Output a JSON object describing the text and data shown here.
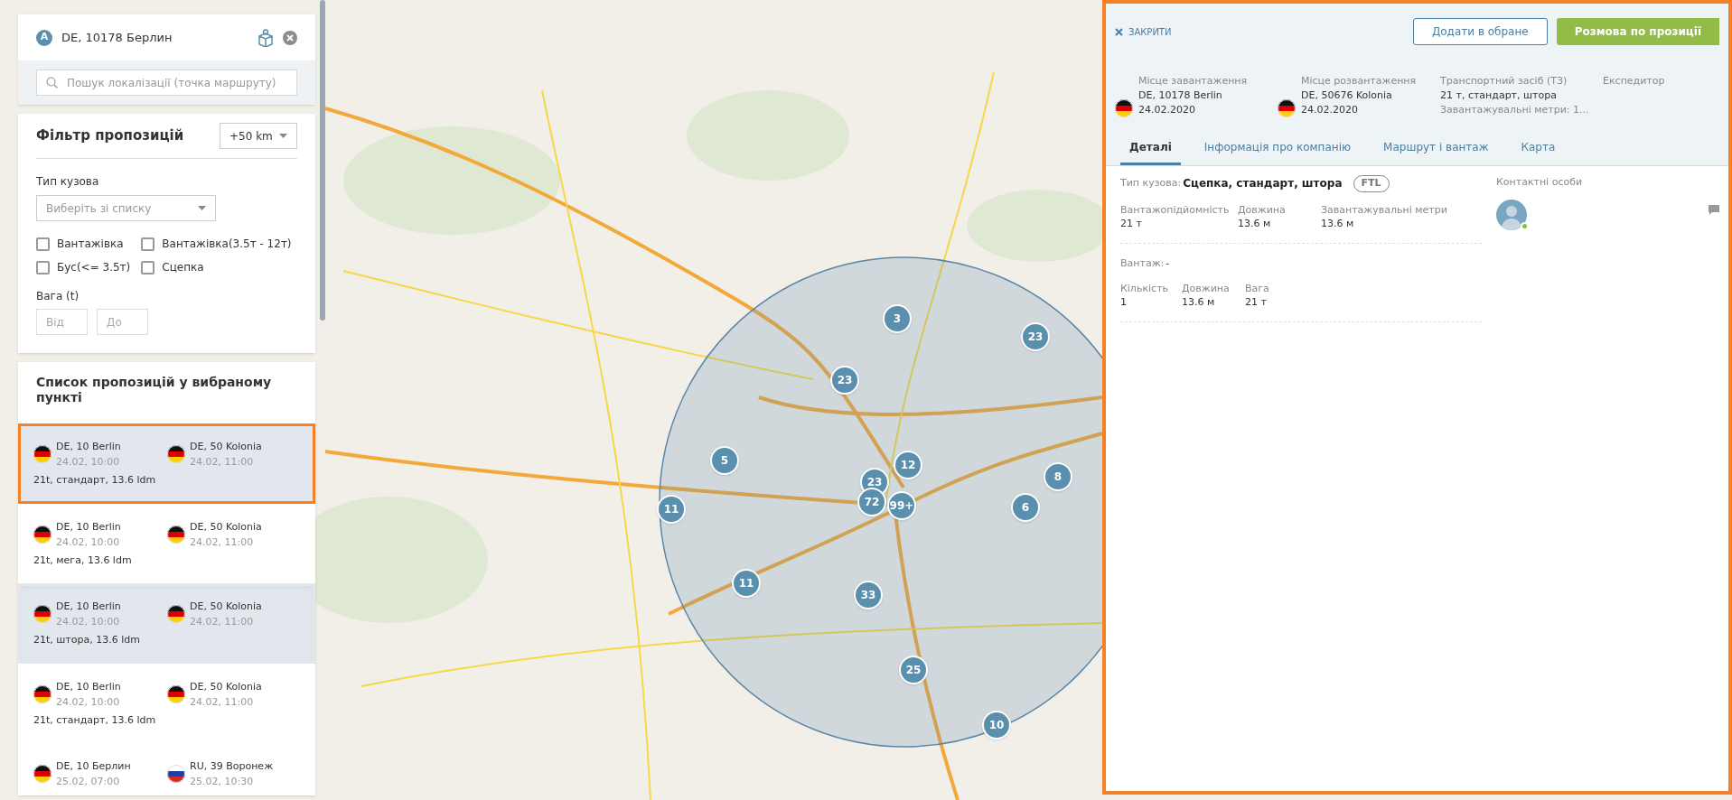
{
  "location": {
    "badge": "A",
    "label": "DE, 10178 Берлин"
  },
  "search": {
    "placeholder": "Пошук локалізації (точка маршруту)"
  },
  "filter": {
    "title": "Фільтр пропозицій",
    "radius": "+50 km",
    "body_type_label": "Тип кузова",
    "body_type_placeholder": "Виберіть зі списку",
    "checkboxes": [
      {
        "label": "Вантажівка",
        "checked": false
      },
      {
        "label": "Вантажівка(3.5т - 12т)",
        "checked": false
      },
      {
        "label": "Бус(<= 3.5т)",
        "checked": false
      },
      {
        "label": "Сцепка",
        "checked": false
      }
    ],
    "weight_label": "Вага (t)",
    "weight_from_placeholder": "Від",
    "weight_to_placeholder": "До"
  },
  "offers": {
    "title": "Список пропозицій у вибраному пункті",
    "items": [
      {
        "from_flag": {
          "kind": "de"
        },
        "from": "DE, 10 Berlin",
        "from_time": "24.02, 10:00",
        "to_flag": {
          "kind": "de"
        },
        "to": "DE, 50 Kolonia",
        "to_time": "24.02, 11:00",
        "summary": "21t, стандарт, 13.6 ldm",
        "selected": true,
        "hovered": false
      },
      {
        "from_flag": {
          "kind": "de"
        },
        "from": "DE, 10 Berlin",
        "from_time": "24.02, 10:00",
        "to_flag": {
          "kind": "de"
        },
        "to": "DE, 50 Kolonia",
        "to_time": "24.02, 11:00",
        "summary": "21t, мега, 13.6 ldm",
        "selected": false,
        "hovered": false
      },
      {
        "from_flag": {
          "kind": "de"
        },
        "from": "DE, 10 Berlin",
        "from_time": "24.02, 10:00",
        "to_flag": {
          "kind": "de"
        },
        "to": "DE, 50 Kolonia",
        "to_time": "24.02, 11:00",
        "summary": "21t, штора, 13.6 ldm",
        "selected": false,
        "hovered": true
      },
      {
        "from_flag": {
          "kind": "de"
        },
        "from": "DE, 10 Berlin",
        "from_time": "24.02, 10:00",
        "to_flag": {
          "kind": "de"
        },
        "to": "DE, 50 Kolonia",
        "to_time": "24.02, 11:00",
        "summary": "21t, стандарт, 13.6 ldm",
        "selected": false,
        "hovered": false
      },
      {
        "from_flag": {
          "kind": "de"
        },
        "from": "DE, 10 Берлин",
        "from_time": "25.02, 07:00",
        "to_flag": {
          "kind": "ru"
        },
        "to": "RU, 39 Воронеж",
        "to_time": "25.02, 10:30",
        "selected": false,
        "hovered": false
      }
    ]
  },
  "map": {
    "clusters": [
      "3",
      "23",
      "23",
      "5",
      "12",
      "8",
      "23",
      "11",
      "72",
      "99+",
      "6",
      "11",
      "33",
      "25",
      "10"
    ]
  },
  "detail": {
    "close": "ЗАКРИТИ",
    "favorite_button": "Додати в обране",
    "chat_button": "Розмова по прозиції",
    "info": [
      {
        "label": "Місце завантаження",
        "flag": {
          "kind": "de"
        },
        "lines": [
          "DE, 10178 Berlin",
          "24.02.2020"
        ]
      },
      {
        "label": "Місце розвантаження",
        "flag": {
          "kind": "de"
        },
        "lines": [
          "DE, 50676 Kolonia",
          "24.02.2020"
        ]
      },
      {
        "label": "Транспортний засіб (ТЗ)",
        "lines": [
          "21 т, стандарт, штора"
        ],
        "note": "Завантажувальні метри: 1..."
      },
      {
        "label": "Експедитор"
      }
    ],
    "tabs": [
      {
        "label": "Деталі",
        "selected": true
      },
      {
        "label": "Інформація про компанію",
        "selected": false
      },
      {
        "label": "Маршрут і вантаж",
        "selected": false
      },
      {
        "label": "Карта",
        "selected": false
      }
    ],
    "body_type_label": "Тип кузова:",
    "body_type_value": "Сцепка, стандарт, штора",
    "badge": "FTL",
    "vehicle_stats": [
      {
        "label": "Вантажопідйомність",
        "value": "21 т"
      },
      {
        "label": "Довжина",
        "value": "13.6 м"
      },
      {
        "label": "Завантажувальні метри",
        "value": "13.6 м"
      }
    ],
    "cargo_label": "Вантаж:",
    "cargo_value": "-",
    "cargo_stats": [
      {
        "label": "Кількість",
        "value": "1"
      },
      {
        "label": "Довжина",
        "value": "13.6 м"
      },
      {
        "label": "Вага",
        "value": "21 т"
      }
    ],
    "contacts_title": "Контактні особи",
    "contact_online": true
  }
}
